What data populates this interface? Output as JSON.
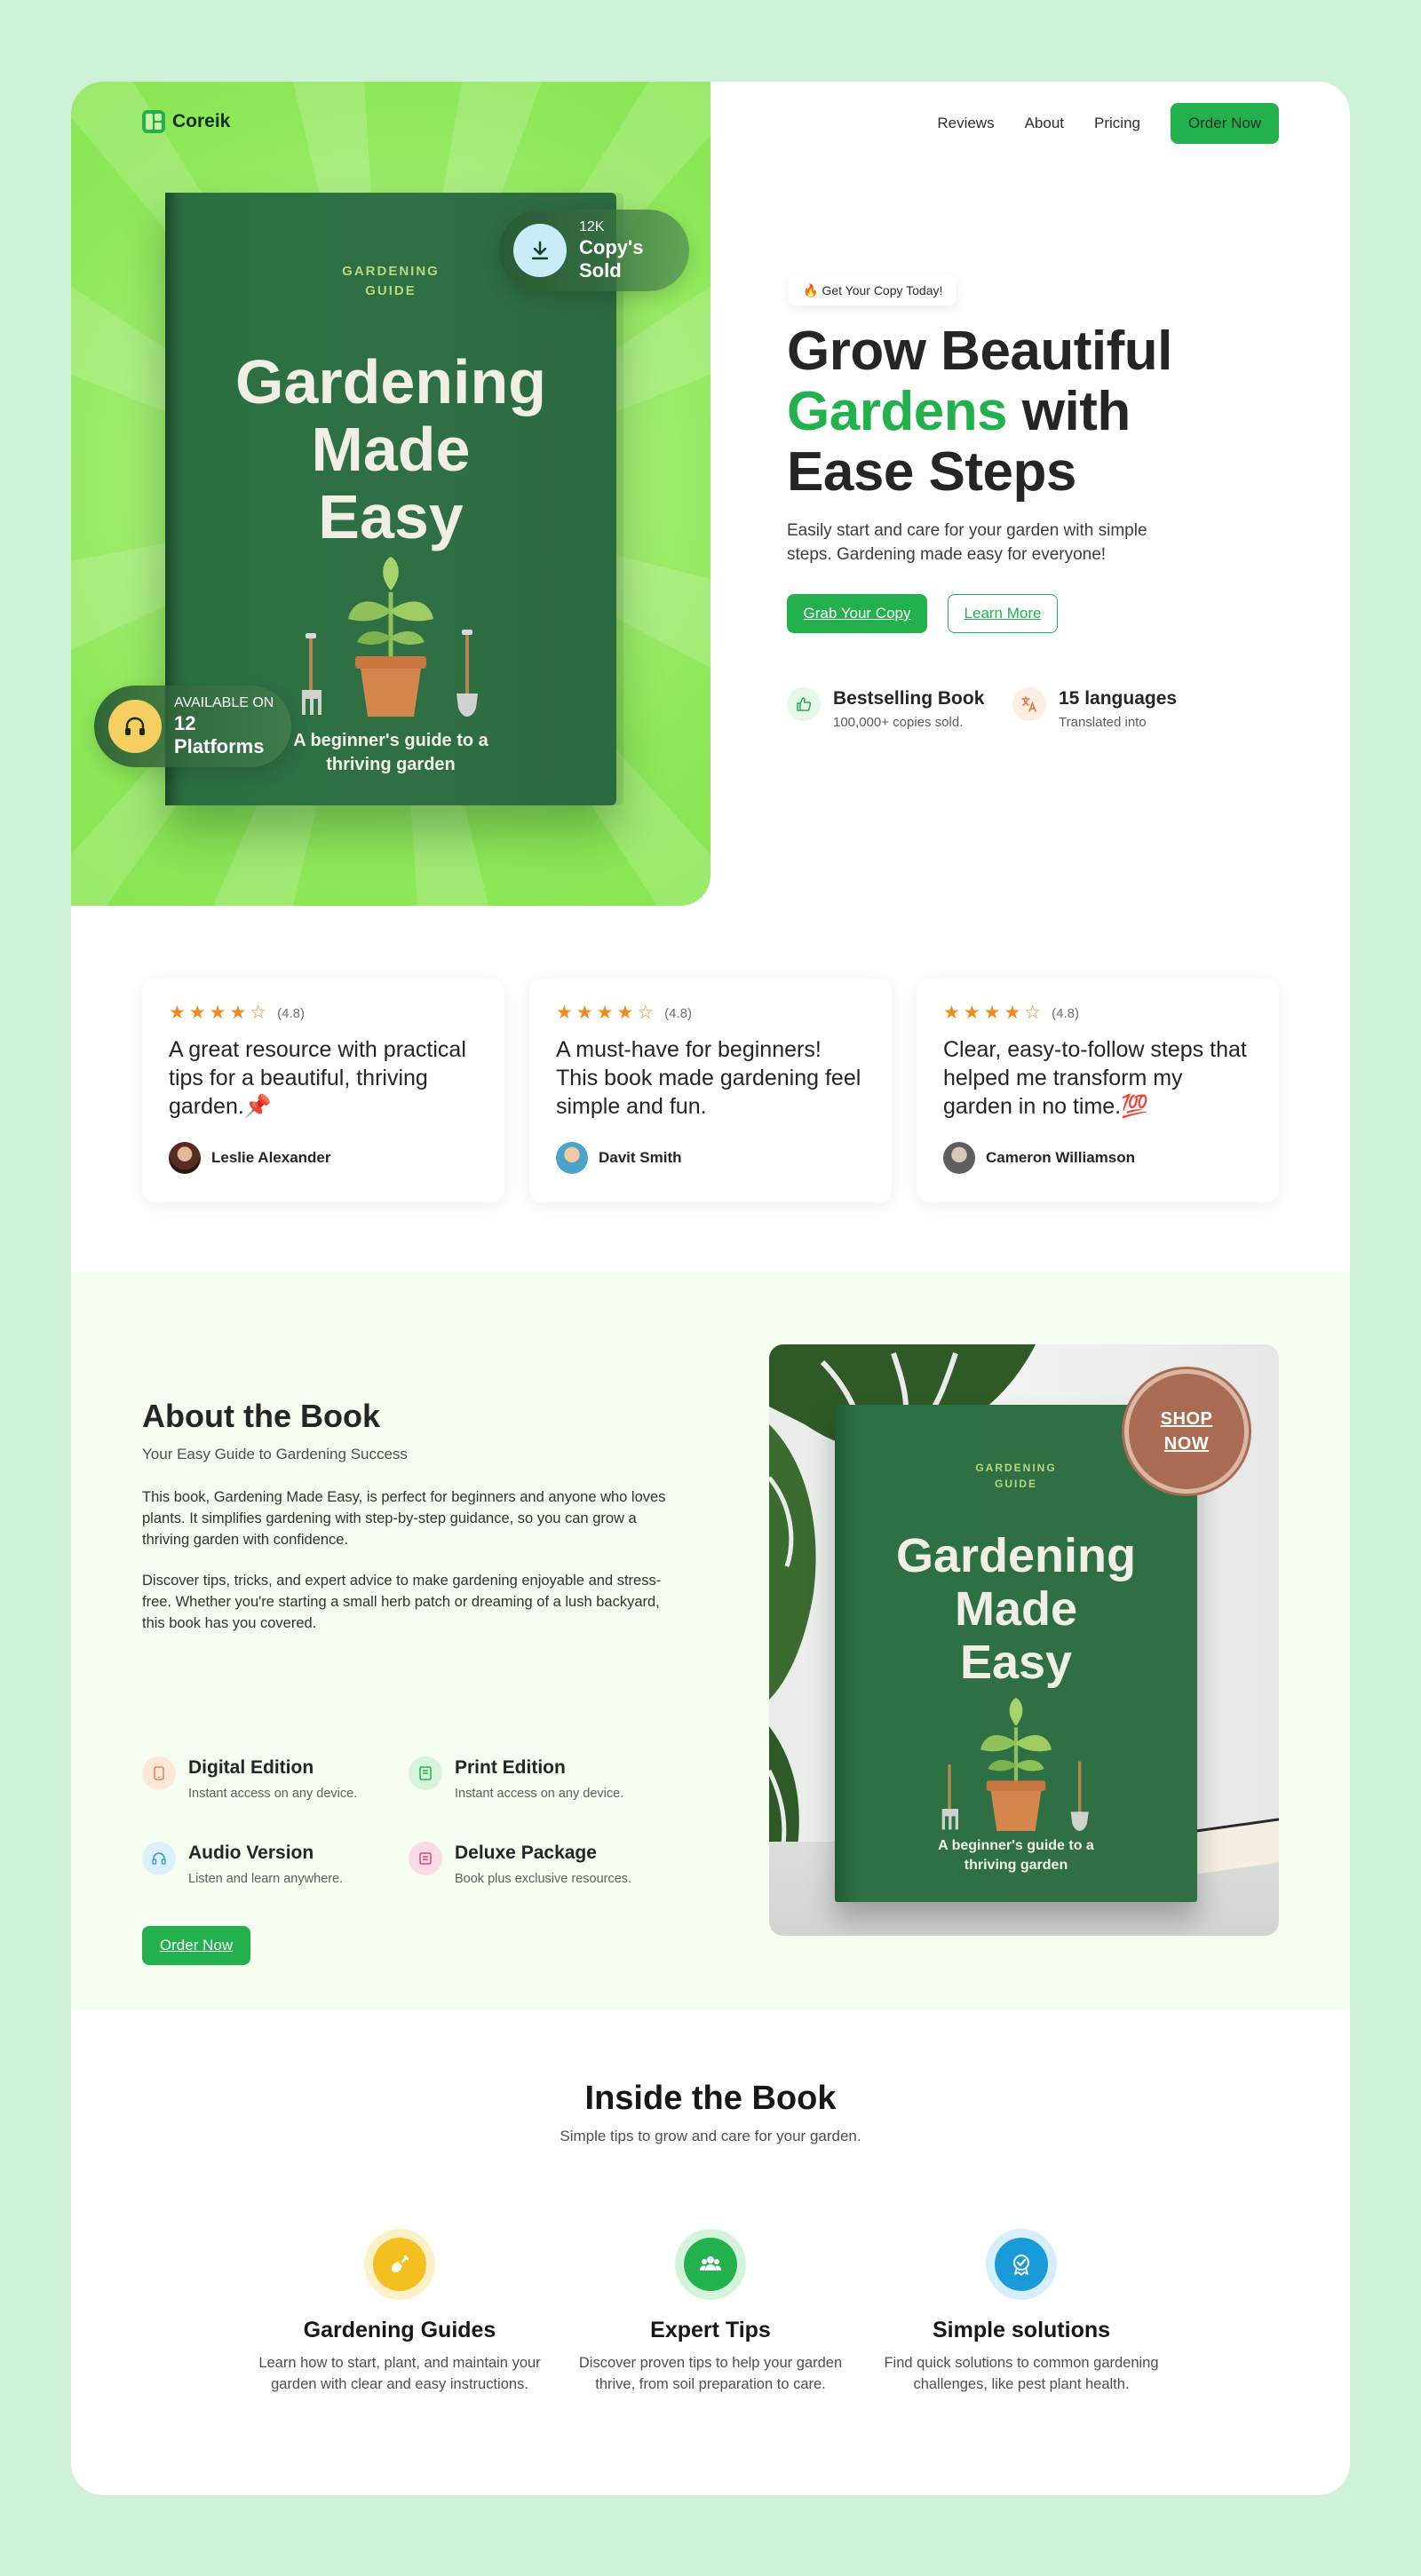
{
  "brand": {
    "name": "Coreik"
  },
  "nav": {
    "items": [
      "Reviews",
      "About",
      "Pricing"
    ],
    "cta": "Order Now"
  },
  "hero": {
    "book": {
      "kicker_line1": "GARDENING",
      "kicker_line2": "GUIDE",
      "title_line1": "Gardening",
      "title_line2": "Made",
      "title_line3": "Easy",
      "subtitle_line1": "A beginner's guide to a",
      "subtitle_line2": "thriving garden"
    },
    "sold_pill": {
      "small": "12K",
      "big": "Copy's Sold",
      "icon": "download-icon"
    },
    "platform_pill": {
      "small": "AVAILABLE ON",
      "big": "12 Platforms",
      "icon": "headphones-icon"
    },
    "badge": {
      "emoji": "🔥",
      "text": "Get Your Copy Today!"
    },
    "heading": {
      "line1": "Grow Beautiful",
      "accent": "Gardens",
      "line2_rest": " with",
      "line3": "Ease Steps"
    },
    "description": "Easily start and care for your garden with simple steps. Gardening made easy for everyone!",
    "primary_cta": "Grab Your Copy",
    "secondary_cta": "Learn More",
    "stats": [
      {
        "title": "Bestselling Book",
        "desc": "100,000+ copies sold.",
        "icon": "thumbs-up-icon"
      },
      {
        "title": "15 languages",
        "desc": "Translated into",
        "icon": "translate-icon"
      }
    ]
  },
  "reviews": [
    {
      "rating": "(4.8)",
      "quote": "A great resource with practical tips for a beautiful, thriving garden.",
      "emoji": "📌",
      "name": "Leslie Alexander"
    },
    {
      "rating": "(4.8)",
      "quote": "A must-have for beginners! This book made gardening feel simple and fun.",
      "emoji": "",
      "name": "Davit Smith"
    },
    {
      "rating": "(4.8)",
      "quote": "Clear, easy-to-follow steps that helped me transform my garden in no time.",
      "emoji": "💯",
      "name": "Cameron Williamson"
    }
  ],
  "about": {
    "title": "About the Book",
    "tagline": "Your Easy Guide to Gardening Success",
    "para1": "This book, Gardening Made Easy, is perfect for beginners and anyone who loves plants. It simplifies gardening with step-by-step guidance, so you can grow a thriving garden with confidence.",
    "para2": "Discover tips, tricks, and expert advice to make gardening enjoyable and stress-free. Whether you're starting a small herb patch or dreaming of a lush backyard, this book has you covered.",
    "features": [
      {
        "title": "Digital Edition",
        "desc": "Instant access on any device.",
        "icon": "tablet-icon"
      },
      {
        "title": "Print Edition",
        "desc": "Instant access on any device.",
        "icon": "book-icon"
      },
      {
        "title": "Audio Version",
        "desc": "Listen and learn anywhere.",
        "icon": "headphones-icon"
      },
      {
        "title": "Deluxe Package",
        "desc": "Book plus exclusive resources.",
        "icon": "package-icon"
      }
    ],
    "cta": "Order Now",
    "shop_line1": "SHOP",
    "shop_line2": "NOW"
  },
  "inside": {
    "title": "Inside the Book",
    "subtitle": "Simple tips to grow and care for your garden.",
    "cards": [
      {
        "title": "Gardening Guides",
        "desc": "Learn how to start, plant, and maintain your garden with clear and easy instructions.",
        "icon": "shovel-icon"
      },
      {
        "title": "Expert Tips",
        "desc": "Discover proven tips to help your garden thrive, from soil preparation to care.",
        "icon": "users-icon"
      },
      {
        "title": "Simple solutions",
        "desc": "Find quick solutions to common gardening challenges, like pest plant health.",
        "icon": "badge-check-icon"
      }
    ]
  },
  "colors": {
    "accent": "#22b14c",
    "hero_bg": "#8fe85a",
    "book": "#2e6f43",
    "star": "#f08a1c"
  }
}
